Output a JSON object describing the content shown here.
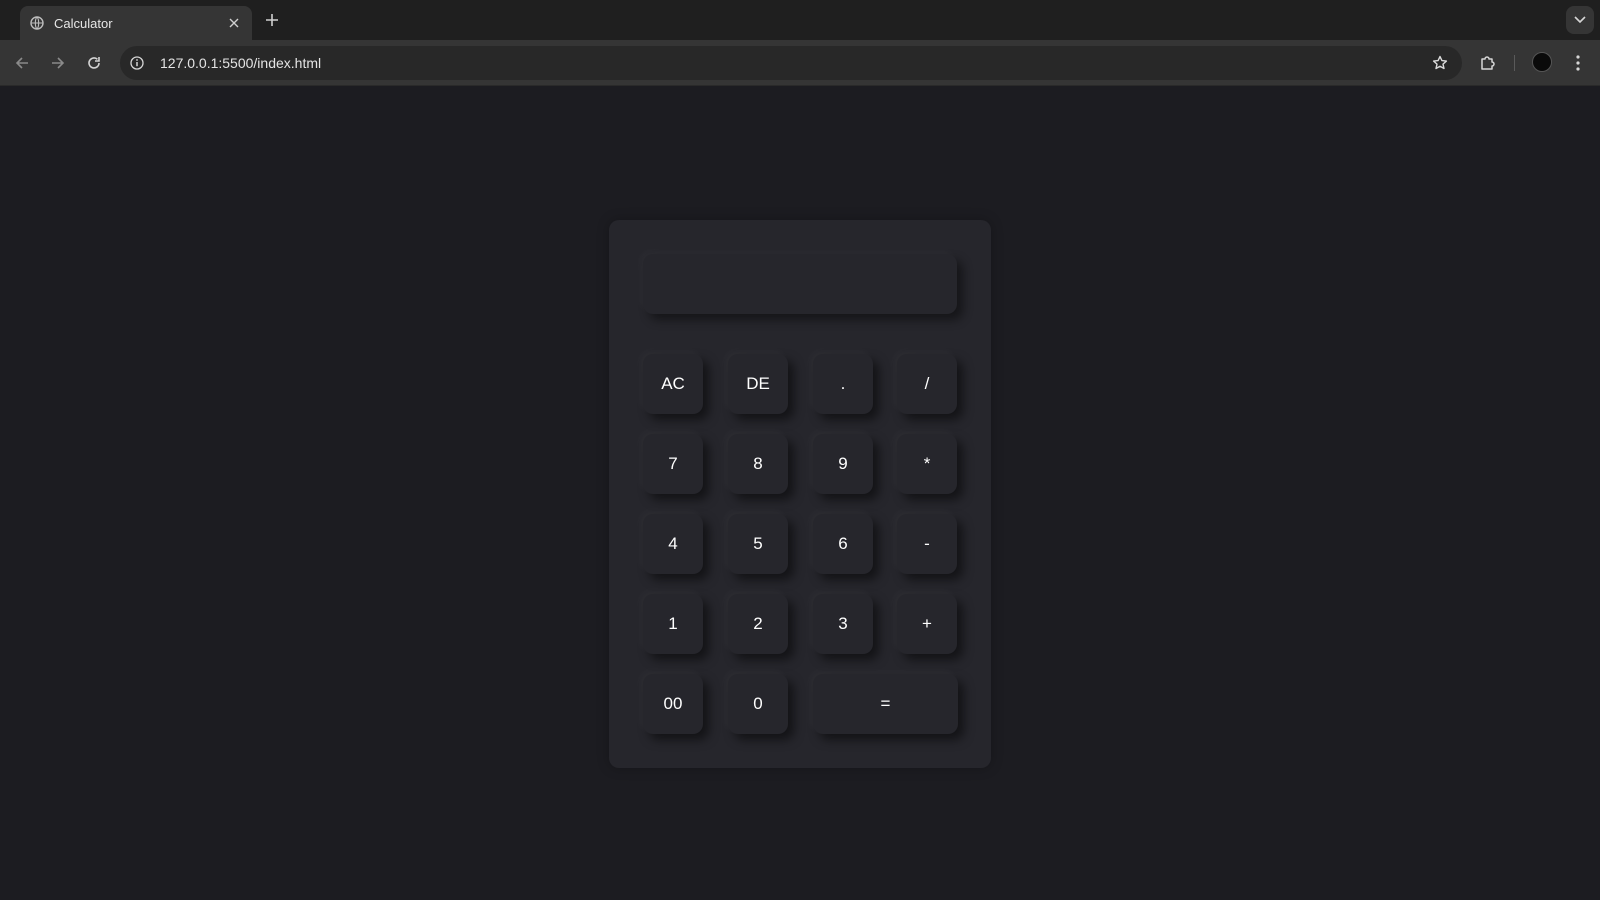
{
  "browser": {
    "tab_title": "Calculator",
    "url": "127.0.0.1:5500/index.html",
    "icons": {
      "favicon": "globe-icon",
      "tab_close": "close-icon",
      "new_tab": "plus-icon",
      "tab_search": "chevron-down-icon",
      "back": "back-arrow-icon",
      "forward": "forward-arrow-icon",
      "reload": "reload-icon",
      "site_info": "info-icon",
      "bookmark": "star-icon",
      "extensions": "puzzle-icon",
      "menu": "kebab-menu-icon"
    }
  },
  "calculator": {
    "display_value": "",
    "keys": {
      "ac": "AC",
      "de": "DE",
      "dot": ".",
      "divide": "/",
      "seven": "7",
      "eight": "8",
      "nine": "9",
      "multiply": "*",
      "four": "4",
      "five": "5",
      "six": "6",
      "minus": "-",
      "one": "1",
      "two": "2",
      "three": "3",
      "plus": "+",
      "double_zero": "00",
      "zero": "0",
      "equals": "="
    }
  },
  "colors": {
    "page_background": "#1c1c21",
    "calculator_body": "#26262c",
    "key_text": "#ffffff"
  }
}
